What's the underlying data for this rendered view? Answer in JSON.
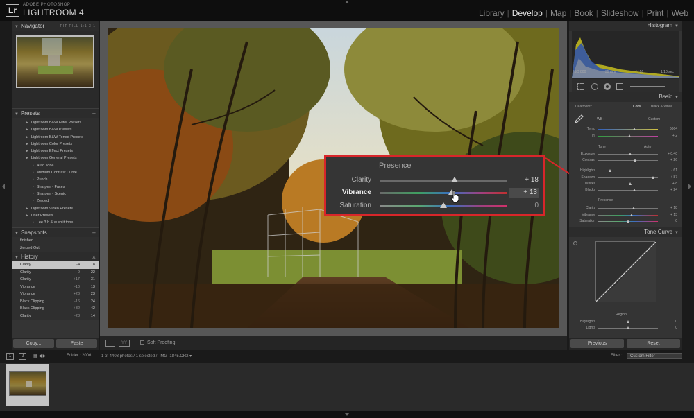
{
  "app": {
    "brand_small": "ADOBE PHOTOSHOP",
    "brand_name": "LIGHTROOM 4",
    "logo": "Lr",
    "modules": [
      {
        "label": "Library",
        "active": false
      },
      {
        "label": "Develop",
        "active": true
      },
      {
        "label": "Map",
        "active": false
      },
      {
        "label": "Book",
        "active": false
      },
      {
        "label": "Slideshow",
        "active": false
      },
      {
        "label": "Print",
        "active": false
      },
      {
        "label": "Web",
        "active": false
      }
    ]
  },
  "navigator": {
    "title": "Navigator",
    "options": "FIT  FILL  1:1  3:1"
  },
  "presets": {
    "title": "Presets",
    "add": "+",
    "items": [
      {
        "label": "Lightroom B&W Filter Presets",
        "level": 1
      },
      {
        "label": "Lightroom B&W Presets",
        "level": 1
      },
      {
        "label": "Lightroom B&W Toned Presets",
        "level": 1
      },
      {
        "label": "Lightroom Color Presets",
        "level": 1
      },
      {
        "label": "Lightroom Effect Presets",
        "level": 1
      },
      {
        "label": "Lightroom General Presets",
        "level": 1
      },
      {
        "label": "Auto Tone",
        "level": 2
      },
      {
        "label": "Medium Contrast Curve",
        "level": 2
      },
      {
        "label": "Punch",
        "level": 2
      },
      {
        "label": "Sharpen - Faces",
        "level": 2
      },
      {
        "label": "Sharpen - Scenic",
        "level": 2
      },
      {
        "label": "Zeroed",
        "level": 2
      },
      {
        "label": "Lightroom Video Presets",
        "level": 1
      },
      {
        "label": "User Presets",
        "level": 1
      },
      {
        "label": "Lee 3 b & w split tone",
        "level": 2
      }
    ]
  },
  "snapshots": {
    "title": "Snapshots",
    "add": "+",
    "items": [
      "finished",
      "Zeroed Out"
    ]
  },
  "history": {
    "title": "History",
    "close": "×",
    "rows": [
      {
        "label": "Clarity",
        "delta": "-4",
        "value": "18",
        "selected": true
      },
      {
        "label": "Clarity",
        "delta": "-9",
        "value": "22",
        "selected": false
      },
      {
        "label": "Clarity",
        "delta": "+17",
        "value": "31",
        "selected": false
      },
      {
        "label": "Vibrance",
        "delta": "-10",
        "value": "13",
        "selected": false
      },
      {
        "label": "Vibrance",
        "delta": "+23",
        "value": "23",
        "selected": false
      },
      {
        "label": "Black Clipping",
        "delta": "-16",
        "value": "24",
        "selected": false
      },
      {
        "label": "Black Clipping",
        "delta": "+32",
        "value": "42",
        "selected": false
      },
      {
        "label": "Clarity",
        "delta": "-28",
        "value": "14",
        "selected": false
      }
    ]
  },
  "left_buttons": {
    "copy": "Copy...",
    "paste": "Paste"
  },
  "toolbar": {
    "soft_proofing": "Soft Proofing",
    "view_mode": "YY"
  },
  "presence": {
    "title": "Presence",
    "sliders": [
      {
        "label": "Clarity",
        "value": "+ 18",
        "fraction": 0.59,
        "bold": false
      },
      {
        "label": "Vibrance",
        "value": "+ 13",
        "fraction": 0.565,
        "bold": true
      },
      {
        "label": "Saturation",
        "value": "0",
        "fraction": 0.5,
        "bold": false
      }
    ]
  },
  "right_panel": {
    "histogram_title": "Histogram",
    "exif": {
      "iso": "ISO 800",
      "focal": "35 mm",
      "aperture": "f / 16",
      "shutter": "1/10 sec"
    },
    "basic_title": "Basic",
    "treatment_label": "Treatment :",
    "treatment_color": "Color",
    "treatment_bw": "Black & White",
    "wb_label": "WB :",
    "wb_value": "Custom",
    "wb_rows": [
      {
        "label": "Temp",
        "value": "6064",
        "fraction": 0.6
      },
      {
        "label": "Tint",
        "value": "+ 2",
        "fraction": 0.52
      }
    ],
    "tone_label": "Tone",
    "tone_auto": "Auto",
    "tone_rows": [
      {
        "label": "Exposure",
        "value": "+ 0.40",
        "fraction": 0.54
      },
      {
        "label": "Contrast",
        "value": "+ 26",
        "fraction": 0.62
      }
    ],
    "tone_rows2": [
      {
        "label": "Highlights",
        "value": "- 61",
        "fraction": 0.2
      },
      {
        "label": "Shadows",
        "value": "+ 87",
        "fraction": 0.92
      },
      {
        "label": "Whites",
        "value": "+ 8",
        "fraction": 0.54
      },
      {
        "label": "Blacks",
        "value": "+ 24",
        "fraction": 0.6
      }
    ],
    "presence_label": "Presence",
    "presence_rows": [
      {
        "label": "Clarity",
        "value": "+ 18",
        "fraction": 0.59
      },
      {
        "label": "Vibrance",
        "value": "+ 13",
        "fraction": 0.56
      },
      {
        "label": "Saturation",
        "value": "0",
        "fraction": 0.5
      }
    ],
    "tone_curve_title": "Tone Curve",
    "region_label": "Region",
    "region_rows": [
      {
        "label": "Highlights",
        "value": "0",
        "fraction": 0.5
      },
      {
        "label": "Lights",
        "value": "0",
        "fraction": 0.5
      }
    ],
    "previous": "Previous",
    "reset": "Reset"
  },
  "filmstrip": {
    "screen1": "1",
    "screen2": "2",
    "folder": "Folder : 2006",
    "info": "1 of 4403 photos / 1 selected / _MG_1845.CR2 ▾",
    "filter_label": "Filter :",
    "filter_value": "Custom Filter"
  },
  "colors": {
    "accent_red": "#d8262a",
    "active_text": "#e6e6e6"
  }
}
